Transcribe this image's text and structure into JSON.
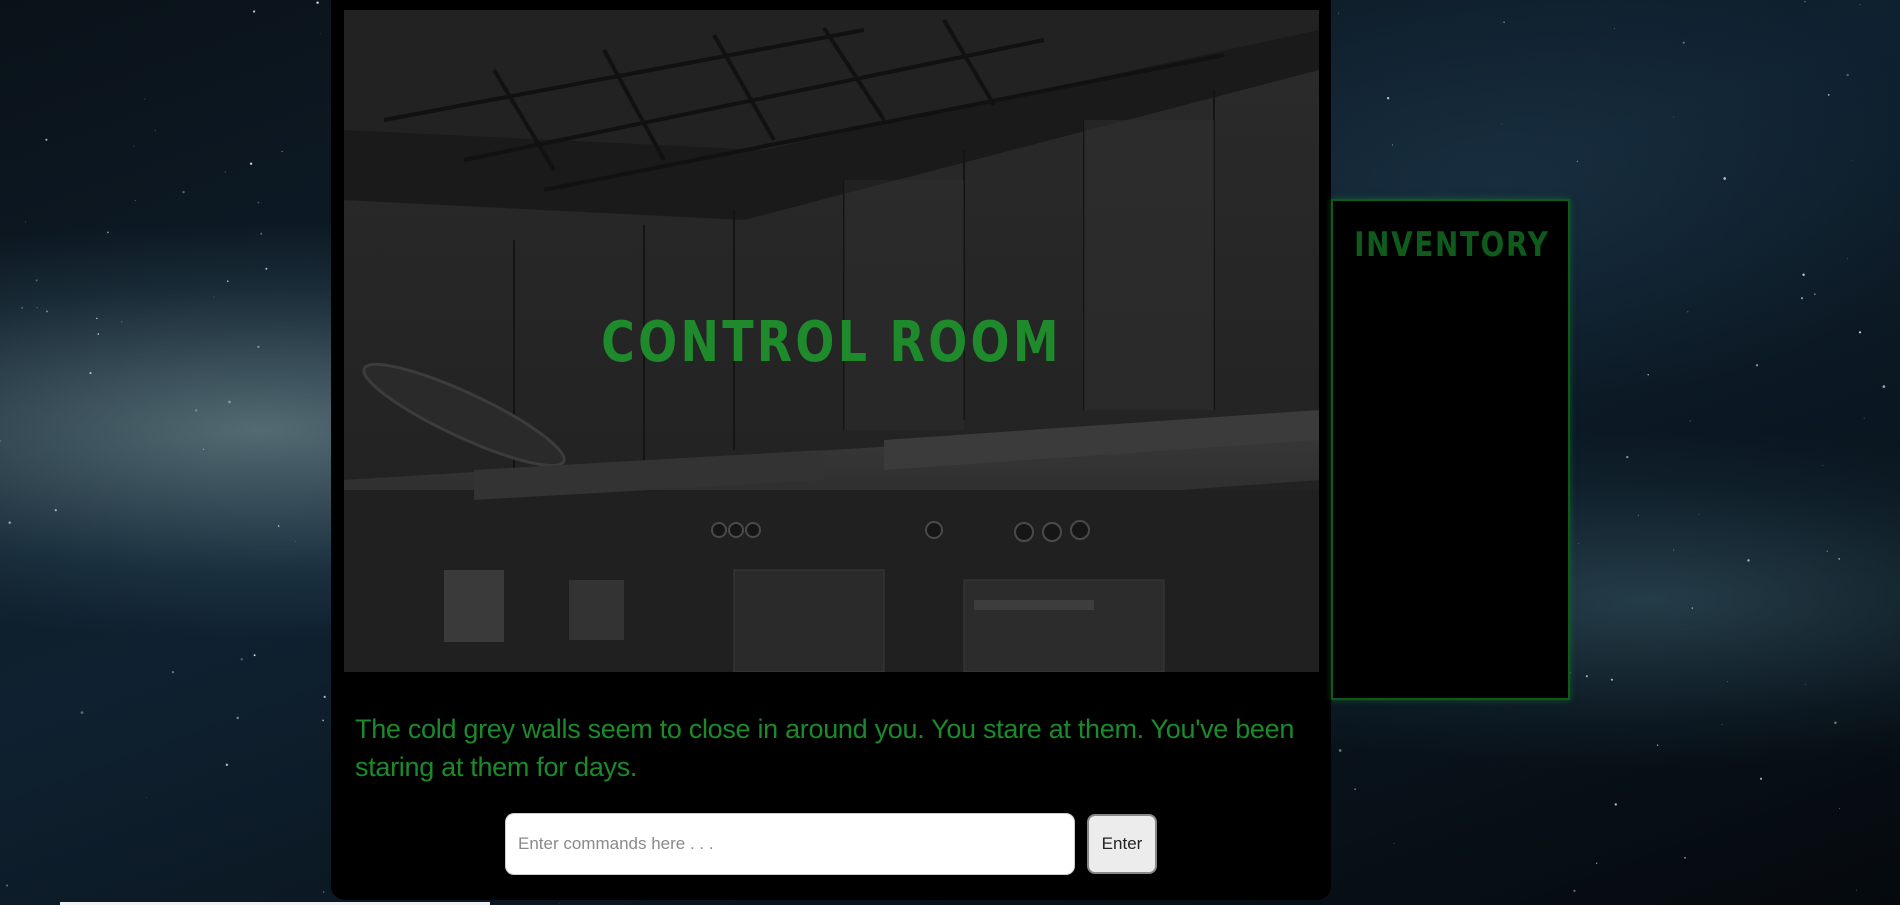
{
  "room": {
    "title": "CONTROL ROOM",
    "description": "The cold grey walls seem to close in around you. You stare at them. You've been staring at them for days."
  },
  "command": {
    "placeholder": "Enter commands here . . .",
    "value": "",
    "button_label": "Enter"
  },
  "inventory": {
    "title": "INVENTORY",
    "items": []
  },
  "colors": {
    "accent_green": "#1b8a2b",
    "inventory_green": "#0f5b1b",
    "panel_background": "#000000"
  },
  "scene_image": "abandoned-kitchen-photo",
  "background_image": "starfield-nebula"
}
